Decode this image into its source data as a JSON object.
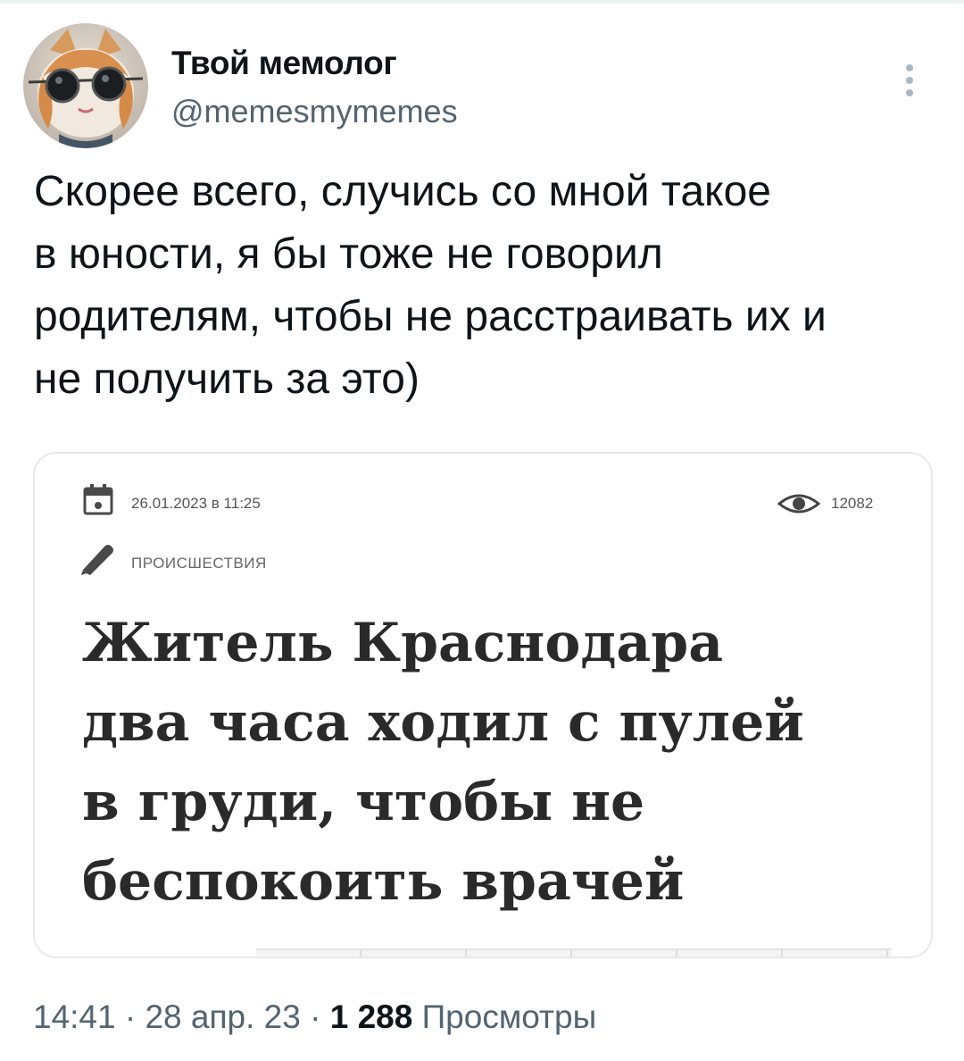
{
  "author": {
    "name": "Твой мемолог",
    "handle": "@memesmymemes"
  },
  "tweet": {
    "text_lines": [
      "Скорее всего, случись со мной такое",
      "в юности, я бы тоже не говорил",
      "родителям, чтобы не расстраивать их и",
      "не получить за это)"
    ]
  },
  "article": {
    "date": "26.01.2023 в 11:25",
    "views": "12082",
    "category": "ПРОИСШЕСТВИЯ",
    "headline_lines": [
      "Житель Краснодара",
      "два часа ходил с пулей",
      "в груди, чтобы не",
      "беспокоить врачей"
    ]
  },
  "footer": {
    "time": "14:41",
    "separator": " · ",
    "date": "28 апр. 23",
    "views_count": "1 288",
    "views_label": " Просмотры"
  },
  "icons": {
    "more": "more-vertical-icon",
    "calendar": "calendar-icon",
    "views": "eye-icon",
    "category": "pencil-icon"
  },
  "colors": {
    "text": "#0f1419",
    "secondary": "#536471",
    "card_border": "#e6e9eb",
    "headline": "#2a2a2a"
  }
}
